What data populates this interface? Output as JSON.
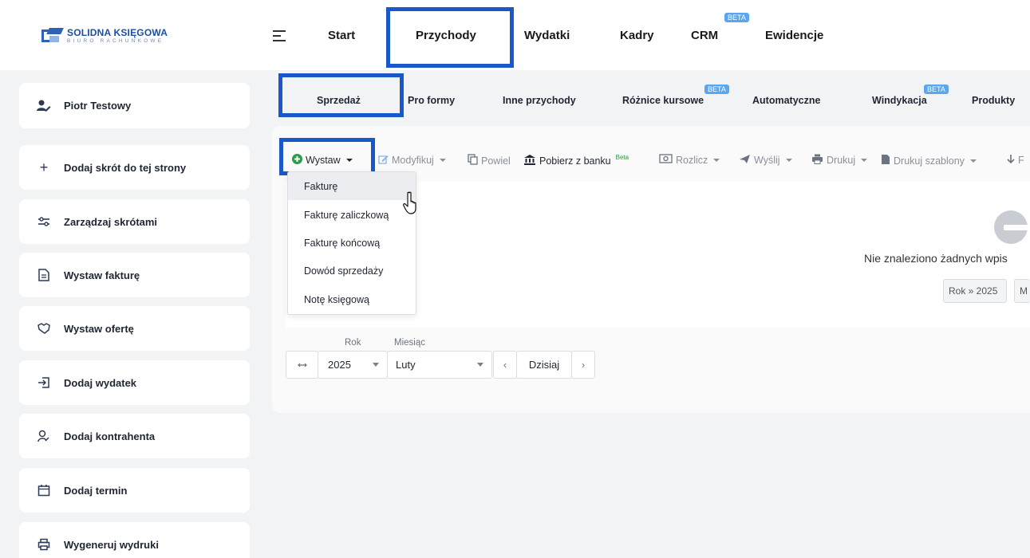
{
  "logo": {
    "line1": "SOLIDNA KSIĘGOWA",
    "line2": "BIURO RACHUNKOWE"
  },
  "topnav": {
    "items": [
      {
        "label": "Start"
      },
      {
        "label": "Przychody"
      },
      {
        "label": "Wydatki"
      },
      {
        "label": "Kadry"
      },
      {
        "label": "CRM",
        "badge": "BETA"
      },
      {
        "label": "Ewidencje"
      }
    ]
  },
  "sidebar": {
    "user": "Piotr Testowy",
    "items": [
      {
        "label": "Dodaj skrót do tej strony",
        "icon": "plus-icon"
      },
      {
        "label": "Zarządzaj skrótami",
        "icon": "sliders-icon"
      },
      {
        "label": "Wystaw fakturę",
        "icon": "document-icon"
      },
      {
        "label": "Wystaw ofertę",
        "icon": "handshake-icon"
      },
      {
        "label": "Dodaj wydatek",
        "icon": "expense-icon"
      },
      {
        "label": "Dodaj kontrahenta",
        "icon": "contact-icon"
      },
      {
        "label": "Dodaj termin",
        "icon": "calendar-icon"
      },
      {
        "label": "Wygeneruj wydruki",
        "icon": "printer-icon"
      }
    ]
  },
  "subnav": {
    "items": [
      {
        "label": "Sprzedaż"
      },
      {
        "label": "Pro formy"
      },
      {
        "label": "Inne przychody"
      },
      {
        "label": "Różnice kursowe",
        "badge": "BETA"
      },
      {
        "label": "Automatyczne"
      },
      {
        "label": "Windykacja",
        "badge": "BETA"
      },
      {
        "label": "Produkty"
      }
    ]
  },
  "toolbar": {
    "wystaw": "Wystaw",
    "modyfikuj": "Modyfikuj",
    "powiel": "Powiel",
    "pobierz": "Pobierz z banku",
    "pobierz_beta": "Beta",
    "rozlicz": "Rozlicz",
    "wyslij": "Wyślij",
    "drukuj": "Drukuj",
    "drukuj_szablony": "Drukuj szablony",
    "more": "F"
  },
  "dropdown": {
    "items": [
      "Fakturę",
      "Fakturę zaliczkową",
      "Fakturę końcową",
      "Dowód sprzedaży",
      "Notę księgową"
    ]
  },
  "empty": {
    "message": "Nie znaleziono żadnych wpis",
    "chip_year": "Rok » 2025",
    "chip_month": "M"
  },
  "filters": {
    "year_label": "Rok",
    "year_value": "2025",
    "month_label": "Miesiąc",
    "month_value": "Luty",
    "today": "Dzisiaj"
  },
  "colors": {
    "highlight": "#1958c9",
    "beta": "#5aa6ef",
    "accent_green": "#2a9a3a"
  }
}
